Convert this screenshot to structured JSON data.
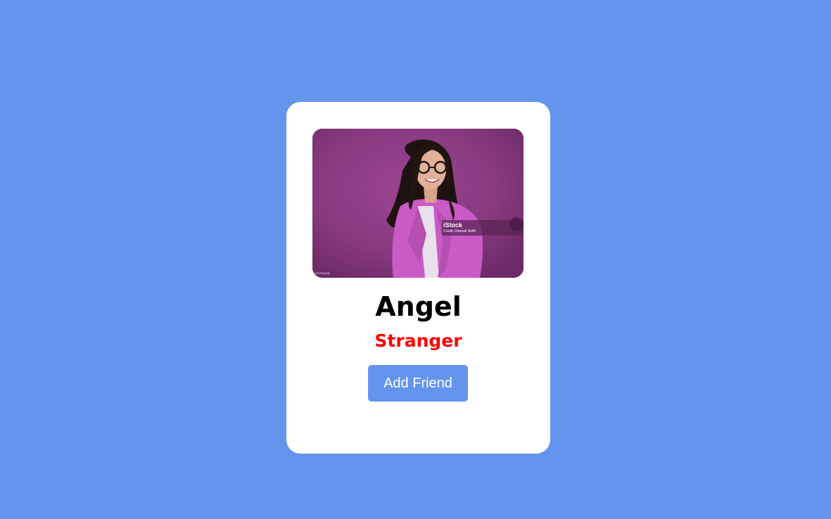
{
  "profile": {
    "name": "Angel",
    "status": "Stranger",
    "add_friend_label": "Add Friend",
    "photo_watermark": "iStock",
    "photo_credit": "Credit: Deepak Sethi",
    "photo_id": "1477794278"
  },
  "colors": {
    "page_background": "#6495ed",
    "card_background": "#ffffff",
    "status_text": "#ff0000",
    "button_background": "#6495ed",
    "button_text": "#ffffff"
  }
}
